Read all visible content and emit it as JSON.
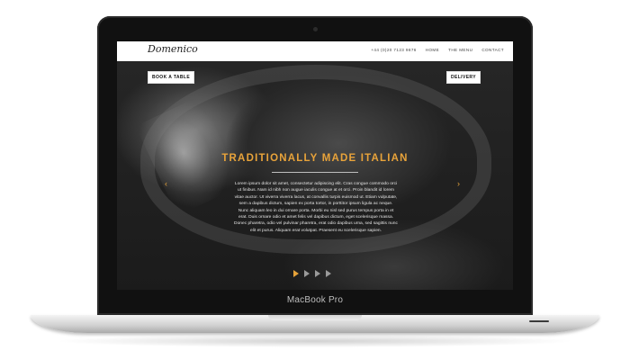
{
  "site": {
    "logo": "Domenico",
    "nav": {
      "phone": "+44 (0)20 7123 9876",
      "home": "HOME",
      "menu": "THE MENU",
      "contact": "CONTACT"
    },
    "buttons": {
      "book": "BOOK A TABLE",
      "delivery": "DELIVERY"
    }
  },
  "hero": {
    "title": "TRADITIONALLY MADE ITALIAN",
    "body": "Lorem ipsum dolor sit amet, consectetur adipiscing elit. Cras congue commodo orci ut finibus. Nam id nibh non augue iaculis congue at et orci. Proin blandit id lorem vitae auctor. Ut viverra viverra lacus, at convallis turpis euismod ut. Etiam vulputate, sem a dapibus dictum, sapien ex porta tortor, in porttitor ipsum ligula ac neque. Nunc aliquam leo in dui ornare porta. Morbi eu nisl sed purus tempus porta in et erat. Duis ornare odio et amet felis vel dapibus dictum, eget scelerisque massa. Donec pharetra, odio vel pulvinar pharetra, erat odio dapibus urna, sed sagittis nunc elit et purus. Aliquam erat volutpat. Praesent eu scelerisque sapien.",
    "arrow_left": "‹",
    "arrow_right": "›"
  },
  "slider": {
    "count": 4,
    "active": 1
  },
  "device": {
    "label": "MacBook Pro"
  },
  "colors": {
    "accent": "#e8a33a",
    "bezel": "#111111"
  }
}
